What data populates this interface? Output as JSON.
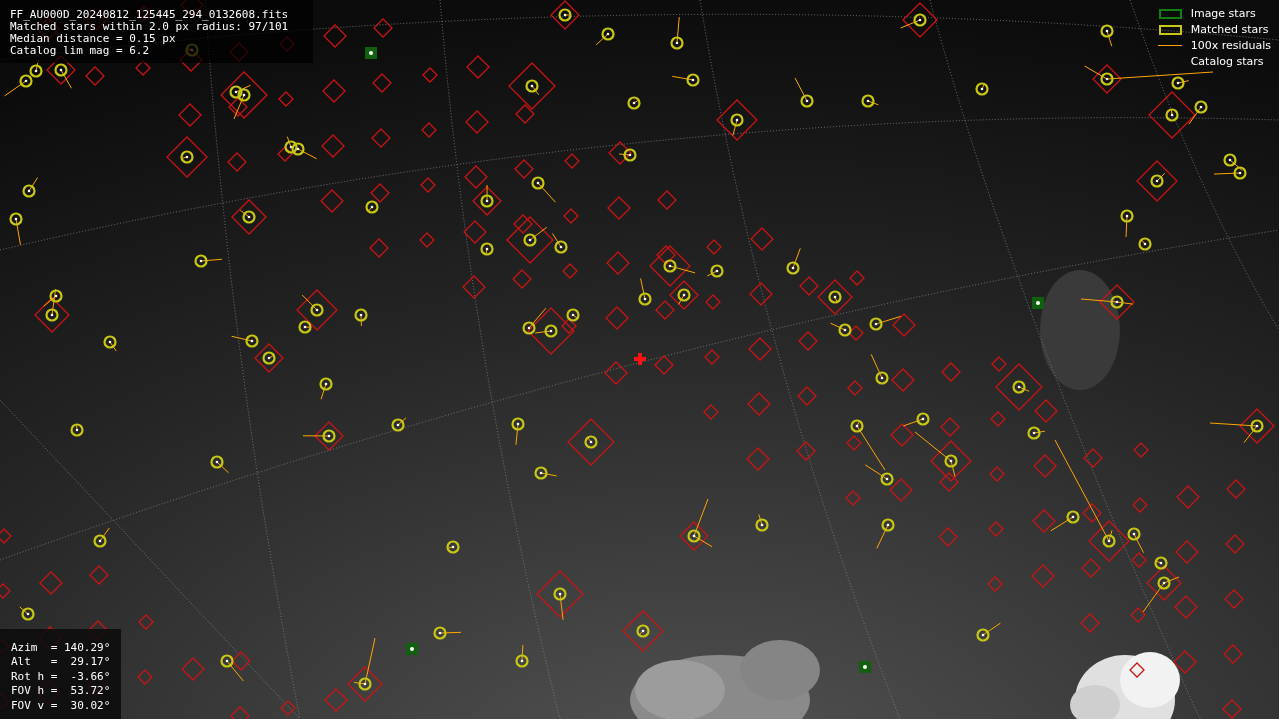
{
  "file_info": {
    "lines": [
      "FF_AU000D_20240812_125445_294_0132608.fits",
      "Matched stars within 2.0 px radius: 97/101",
      "Median distance = 0.15 px",
      "Catalog lim mag = 6.2"
    ]
  },
  "legend": [
    {
      "label": "Image stars",
      "kind": "box",
      "color": "#108010"
    },
    {
      "label": "Matched stars",
      "kind": "box",
      "color": "#c8c814"
    },
    {
      "label": "100x residuals",
      "kind": "line",
      "color": "#ffa500"
    },
    {
      "label": "Catalog stars",
      "kind": "blank"
    }
  ],
  "pointing": {
    "lines": [
      "Azim  = 140.29°",
      "Alt   =  29.17°",
      "Rot h =  -3.66°",
      "FOV h =  53.72°",
      "FOV v =  30.02°"
    ]
  }
}
